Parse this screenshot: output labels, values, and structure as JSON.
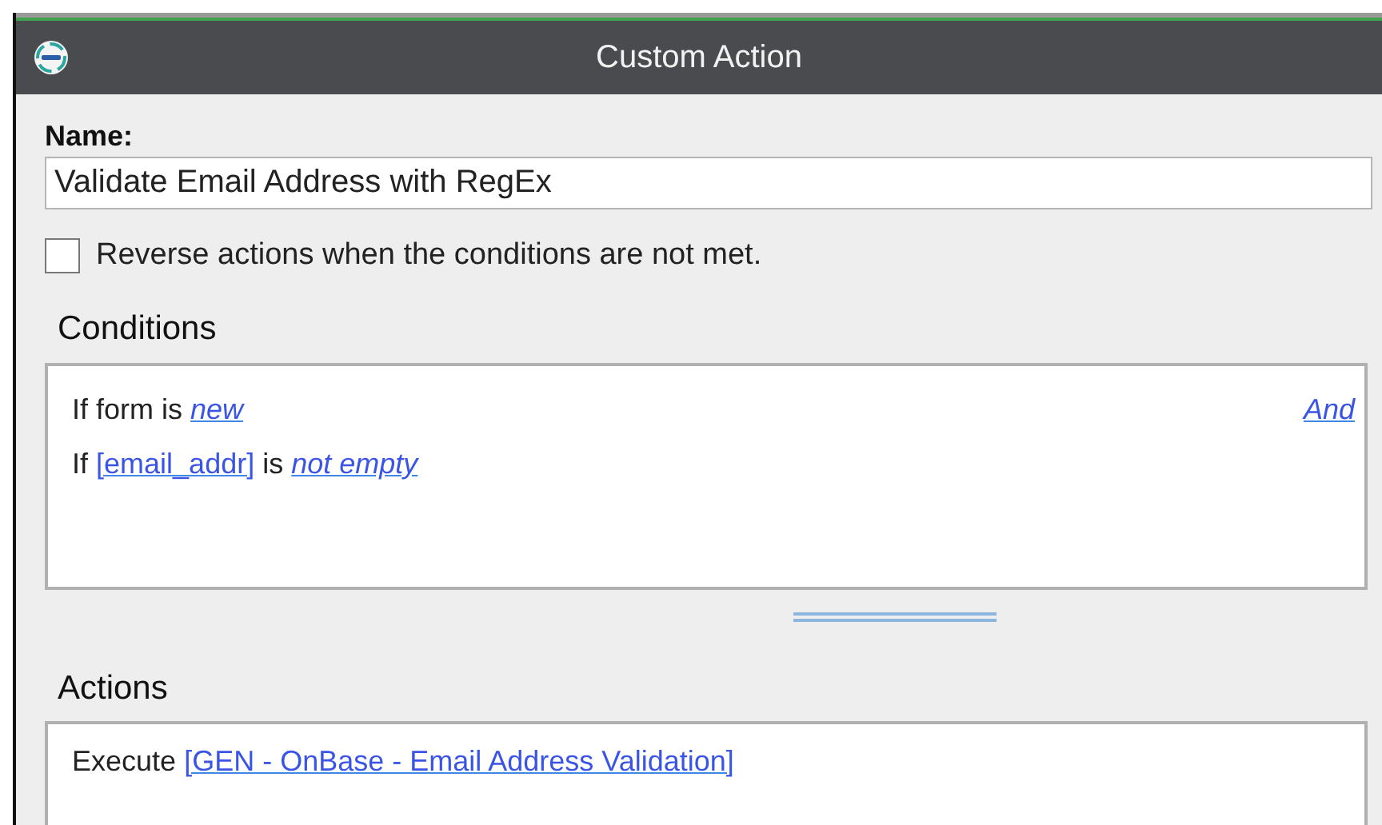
{
  "window": {
    "title": "Custom Action"
  },
  "name_field": {
    "label": "Name:",
    "value": "Validate Email Address with RegEx"
  },
  "reverse_option": {
    "label": "Reverse actions when the conditions are not met.",
    "checked": false
  },
  "conditions": {
    "heading": "Conditions",
    "combinator": "And",
    "lines": [
      {
        "parts": [
          {
            "kind": "text",
            "text": "If form is"
          },
          {
            "kind": "value",
            "text": "new"
          }
        ]
      },
      {
        "parts": [
          {
            "kind": "text",
            "text": "If"
          },
          {
            "kind": "field",
            "text": "[email_addr]"
          },
          {
            "kind": "text",
            "text": "is"
          },
          {
            "kind": "value",
            "text": "not empty"
          }
        ]
      }
    ]
  },
  "actions": {
    "heading": "Actions",
    "lines": [
      {
        "parts": [
          {
            "kind": "text",
            "text": "Execute"
          },
          {
            "kind": "field",
            "text": "[GEN - OnBase - Email Address Validation]"
          }
        ]
      }
    ]
  }
}
